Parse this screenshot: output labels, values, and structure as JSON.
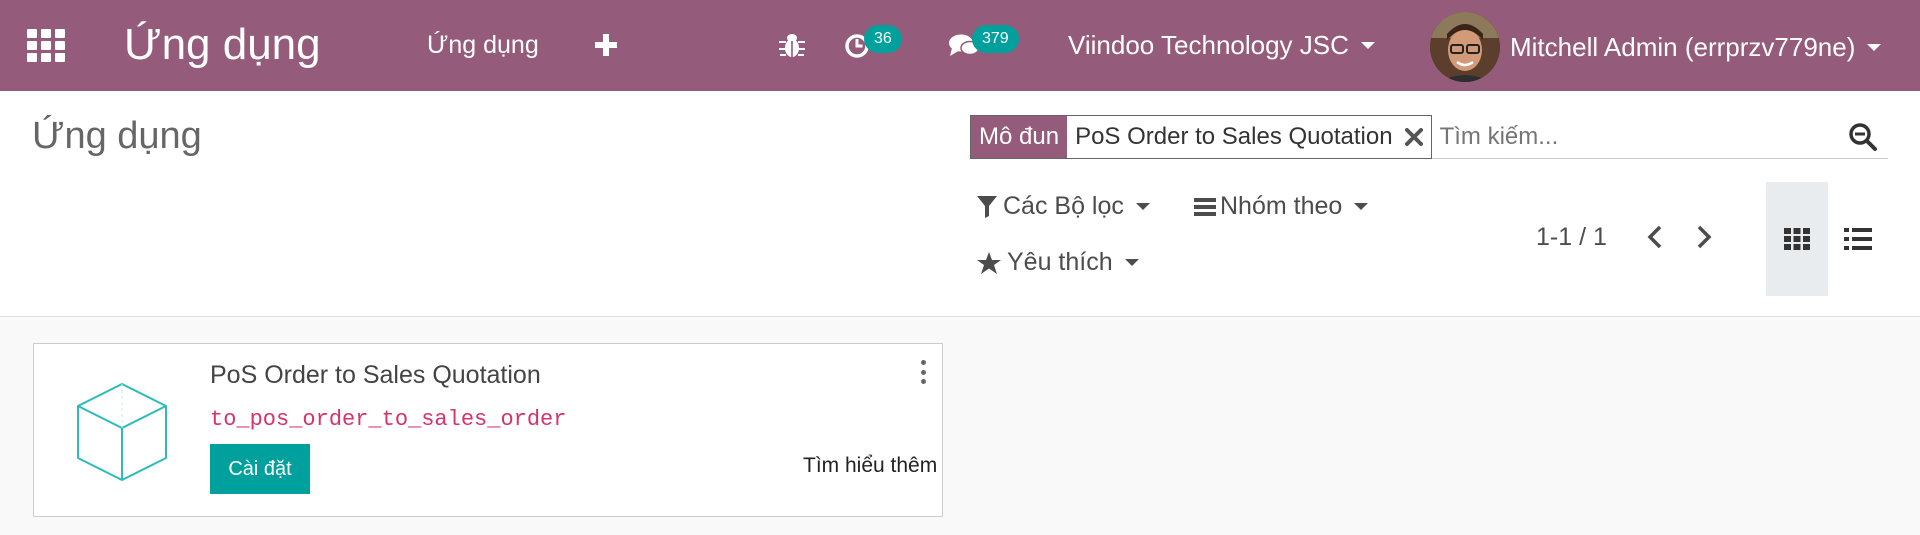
{
  "navbar": {
    "brand": "Ứng dụng",
    "menu_apps": "Ứng dụng",
    "activity_count": "36",
    "message_count": "379",
    "company": "Viindoo Technology JSC",
    "user": "Mitchell Admin (errprzv779ne)",
    "color": "#955b7a"
  },
  "control_panel": {
    "title": "Ứng dụng",
    "facet": {
      "label": "Mô đun",
      "value": "PoS Order to Sales Quotation"
    },
    "search_placeholder": "Tìm kiếm...",
    "filters": "Các Bộ lọc",
    "group_by": "Nhóm theo",
    "favorites": "Yêu thích",
    "pager": "1-1 / 1"
  },
  "modules": [
    {
      "name": "PoS Order to Sales Quotation",
      "technical_name": "to_pos_order_to_sales_order",
      "install_label": "Cài đặt",
      "learn_more": "Tìm hiểu thêm"
    }
  ],
  "icons": {
    "apps": "apps-grid-icon",
    "plus": "plus-icon",
    "bug": "bug-icon",
    "activity": "clock-icon",
    "messages": "chat-icon",
    "search": "search-icon",
    "remove": "close-icon",
    "filter": "filter-icon",
    "group": "bars-icon",
    "favorite": "star-icon",
    "kanban": "kanban-view-icon",
    "list": "list-view-icon",
    "module": "cube-icon"
  },
  "colors": {
    "accent": "#00a09d",
    "tech_name": "#d6336c"
  }
}
